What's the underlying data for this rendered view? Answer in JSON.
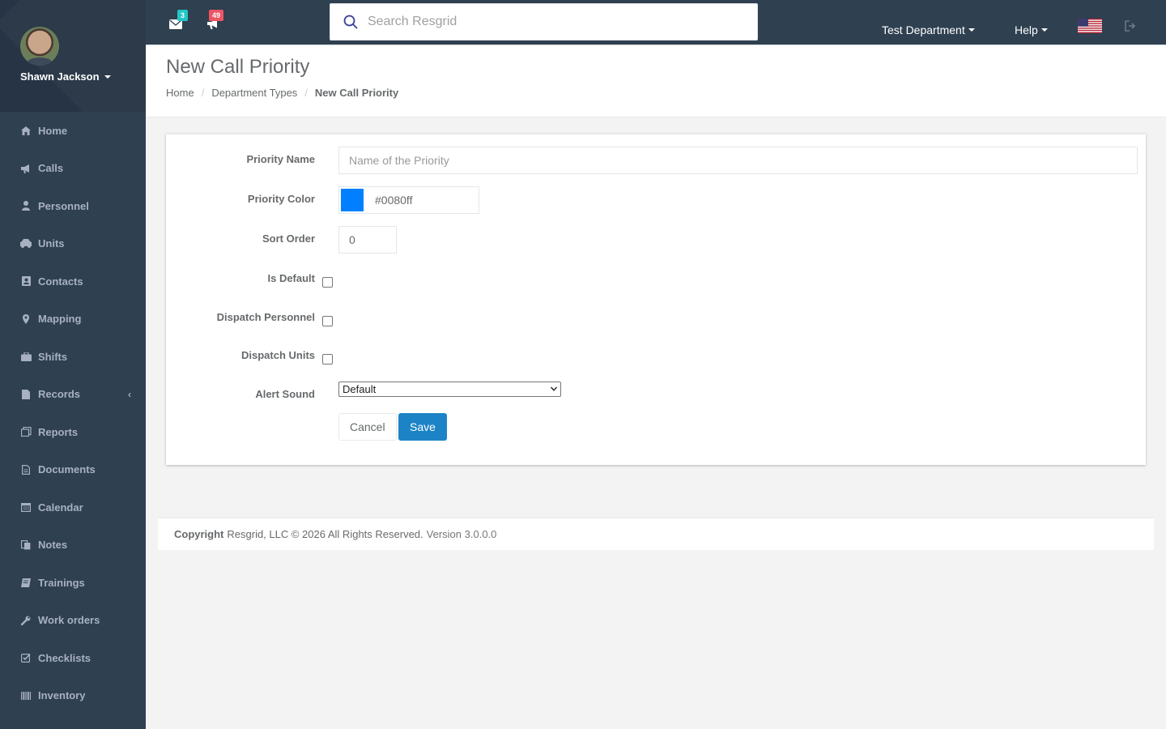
{
  "user": {
    "name": "Shawn Jackson"
  },
  "sidebar": {
    "items": [
      {
        "label": "Home",
        "icon": "home-icon"
      },
      {
        "label": "Calls",
        "icon": "bullhorn-icon"
      },
      {
        "label": "Personnel",
        "icon": "user-icon"
      },
      {
        "label": "Units",
        "icon": "truck-icon"
      },
      {
        "label": "Contacts",
        "icon": "address-book-icon"
      },
      {
        "label": "Mapping",
        "icon": "map-marker-icon"
      },
      {
        "label": "Shifts",
        "icon": "briefcase-icon"
      },
      {
        "label": "Records",
        "icon": "file-icon"
      },
      {
        "label": "Reports",
        "icon": "report-icon"
      },
      {
        "label": "Documents",
        "icon": "document-icon"
      },
      {
        "label": "Calendar",
        "icon": "calendar-icon"
      },
      {
        "label": "Notes",
        "icon": "notes-icon"
      },
      {
        "label": "Trainings",
        "icon": "book-icon"
      },
      {
        "label": "Work orders",
        "icon": "wrench-icon"
      },
      {
        "label": "Checklists",
        "icon": "checklist-icon"
      },
      {
        "label": "Inventory",
        "icon": "barcode-icon"
      }
    ]
  },
  "topbar": {
    "messages_count": "3",
    "calls_count": "49",
    "search_placeholder": "Search Resgrid",
    "department": "Test Department",
    "help": "Help"
  },
  "page": {
    "title": "New Call Priority",
    "breadcrumb": [
      "Home",
      "Department Types",
      "New Call Priority"
    ]
  },
  "form": {
    "priority_name_label": "Priority Name",
    "priority_name_placeholder": "Name of the Priority",
    "priority_color_label": "Priority Color",
    "priority_color_value": "#0080ff",
    "sort_order_label": "Sort Order",
    "sort_order_value": "0",
    "is_default_label": "Is Default",
    "dispatch_personnel_label": "Dispatch Personnel",
    "dispatch_units_label": "Dispatch Units",
    "alert_sound_label": "Alert Sound",
    "alert_sound_value": "Default",
    "cancel_label": "Cancel",
    "save_label": "Save"
  },
  "footer": {
    "copyright_label": "Copyright",
    "copyright_text": "Resgrid, LLC © 2026 All Rights Reserved.",
    "version": "Version 3.0.0.0"
  },
  "colors": {
    "sidebar": "#2f4050",
    "primary": "#1c84c6",
    "badge_messages": "#23c6c8",
    "badge_calls": "#ed5565"
  }
}
